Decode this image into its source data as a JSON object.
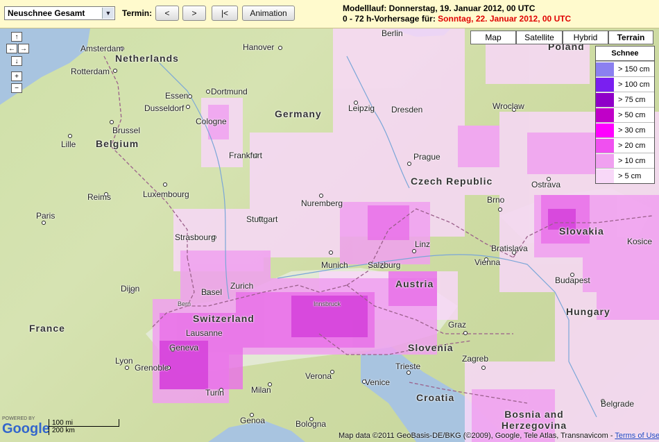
{
  "toolbar": {
    "select_value": "Neuschnee Gesamt",
    "termin_label": "Termin:",
    "prev_label": "<",
    "next_label": ">",
    "first_label": "|<",
    "animation_label": "Animation",
    "modelllauf": "Modelllauf: Donnerstag, 19. Januar 2012, 00 UTC",
    "vorhersage_prefix": "0 - 72 h-Vorhersage für:",
    "vorhersage_date": "Sonntag, 22. Januar 2012, 00 UTC"
  },
  "map_types": [
    "Map",
    "Satellite",
    "Hybrid",
    "Terrain"
  ],
  "active_map_type": "Terrain",
  "legend": {
    "title": "Schnee",
    "items": [
      {
        "label": "> 150 cm",
        "color": "#8b80f0"
      },
      {
        "label": "> 100 cm",
        "color": "#7a1ff0"
      },
      {
        "label": "> 75 cm",
        "color": "#8f00c8"
      },
      {
        "label": "> 50 cm",
        "color": "#c000c8"
      },
      {
        "label": "> 30 cm",
        "color": "#ff00ff"
      },
      {
        "label": "> 20 cm",
        "color": "#f050f0"
      },
      {
        "label": "> 10 cm",
        "color": "#f0a0f0"
      },
      {
        "label": "> 5 cm",
        "color": "#f8d8f8"
      }
    ]
  },
  "countries": [
    "Netherlands",
    "Germany",
    "Belgium",
    "France",
    "Switzerland",
    "Austria",
    "Czech Republic",
    "Slovakia",
    "Hungary",
    "Slovenia",
    "Croatia",
    "Poland",
    "Bosnia and Herzegovina"
  ],
  "cities": [
    "Berlin",
    "Amsterdam",
    "Hanover",
    "Rotterdam",
    "Dortmund",
    "Essen",
    "Dusseldorf",
    "Cologne",
    "Frankfurt",
    "Brussel",
    "Luxembourg",
    "Strasbourg",
    "Stuttgart",
    "Nuremberg",
    "Munich",
    "Zurich",
    "Prague",
    "Dresden",
    "Leipzig",
    "Vienna",
    "Bratislava",
    "Budapest",
    "Paris",
    "Lyon",
    "Geneva",
    "Milan",
    "Verona",
    "Venice",
    "Zagreb",
    "Lille",
    "Reims",
    "Dijon",
    "Salzburg",
    "Innsbruck",
    "Linz",
    "Graz",
    "Wroclaw",
    "Brno",
    "Ostrava",
    "Kosice",
    "Grenoble",
    "Turin",
    "Genoa",
    "Bologna",
    "Belgrade",
    "Trieste",
    "Basel",
    "Bern",
    "Lausanne"
  ],
  "scale": {
    "mi": "100 mi",
    "km": "200 km"
  },
  "google_logo": "Google",
  "powered_by": "POWERED BY",
  "copyright": "Map data ©2011 GeoBasis-DE/BKG (©2009), Google, Tele Atlas, Transnavicom -",
  "terms_link": "Terms of Use"
}
